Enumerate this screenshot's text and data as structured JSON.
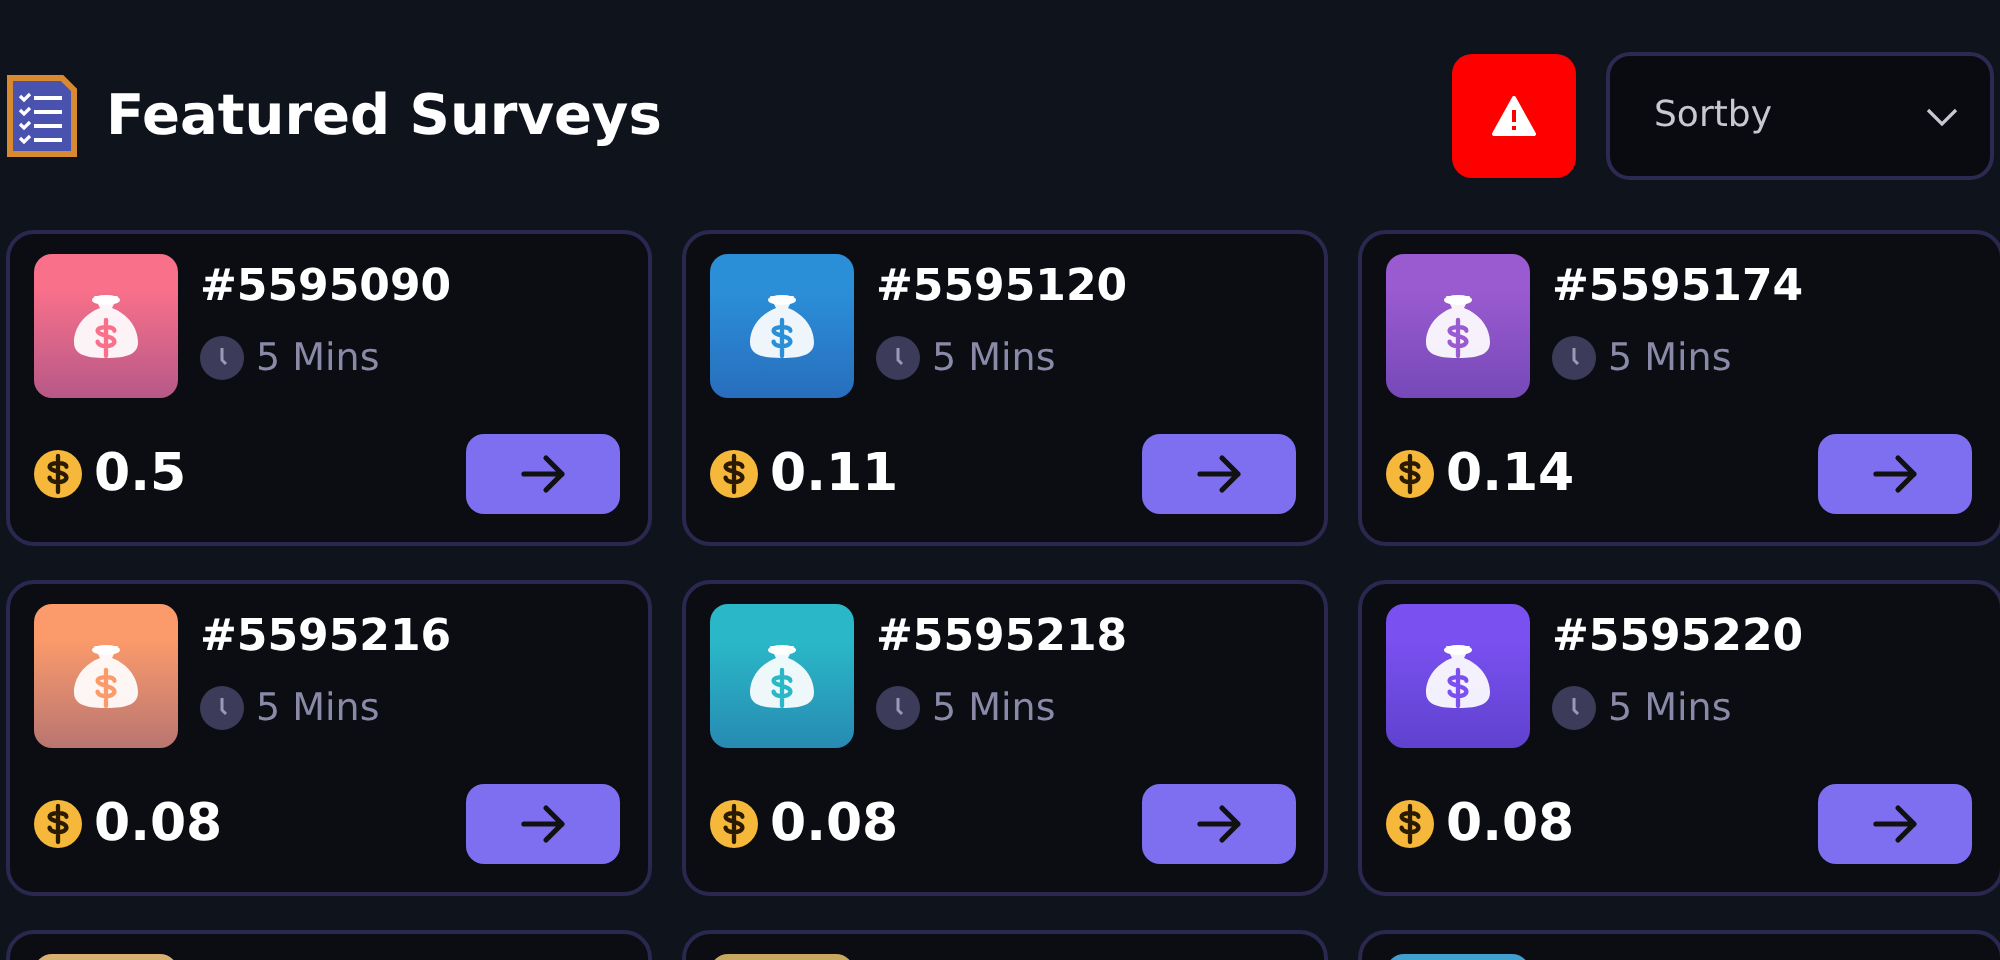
{
  "header": {
    "title": "Featured Surveys",
    "sort": {
      "placeholder": "Sortby"
    }
  },
  "surveys": [
    {
      "id": "#5595090",
      "duration": "5 Mins",
      "reward": "0.5",
      "color": "#f8708a"
    },
    {
      "id": "#5595120",
      "duration": "5 Mins",
      "reward": "0.11",
      "color": "#2b8fd8"
    },
    {
      "id": "#5595174",
      "duration": "5 Mins",
      "reward": "0.14",
      "color": "#9a5ad0"
    },
    {
      "id": "#5595216",
      "duration": "5 Mins",
      "reward": "0.08",
      "color": "#fb9a6a"
    },
    {
      "id": "#5595218",
      "duration": "5 Mins",
      "reward": "0.08",
      "color": "#2ab8c8"
    },
    {
      "id": "#5595220",
      "duration": "5 Mins",
      "reward": "0.08",
      "color": "#7a50f0"
    },
    {
      "color": "#d8b070"
    },
    {
      "color": "#c8a860"
    },
    {
      "color": "#40a0d0"
    }
  ]
}
